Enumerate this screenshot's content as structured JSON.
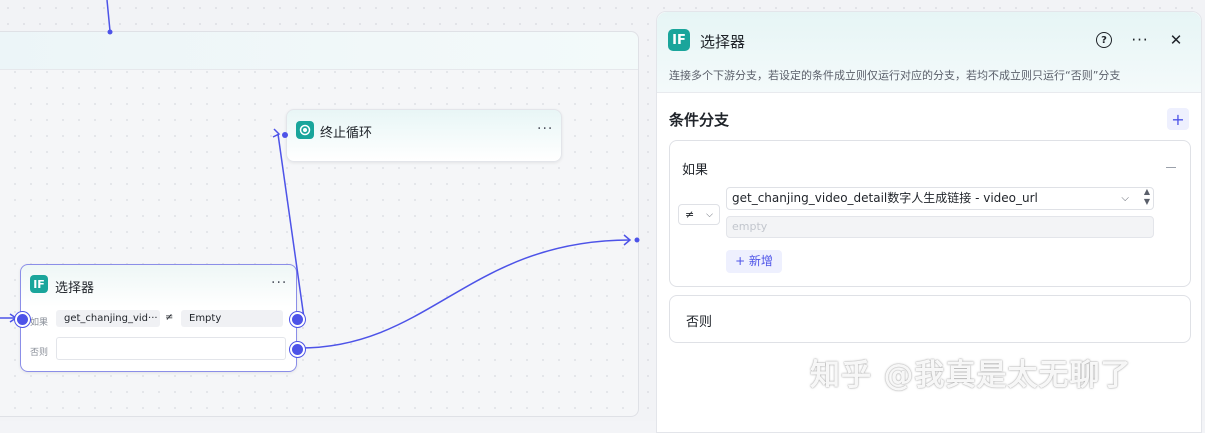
{
  "canvas": {
    "stop_node": {
      "title": "终止循环",
      "more": "···"
    },
    "if_node": {
      "title": "选择器",
      "icon": "IF",
      "more": "···",
      "if_label": "如果",
      "else_label": "否则",
      "left_var": "get_chanjing_vid···",
      "operator": "≠",
      "right_value": "Empty"
    }
  },
  "panel": {
    "icon": "IF",
    "title": "选择器",
    "description": "连接多个下游分支，若设定的条件成立则仅运行对应的分支，若均不成立则只运行“否则”分支",
    "help": "?",
    "more": "···",
    "close": "✕",
    "section_title": "条件分支",
    "add_branch": "+",
    "if_card": {
      "label": "如果",
      "operator": "≠",
      "variable": "get_chanjing_video_detail数字人生成链接 - video_url",
      "value_placeholder": "empty",
      "add_condition": "+ 新增"
    },
    "else_card": {
      "label": "否则"
    }
  },
  "watermark": "知乎 @我真是太无聊了",
  "colors": {
    "accent": "#4d53e8",
    "brand": "#1aa59b"
  }
}
